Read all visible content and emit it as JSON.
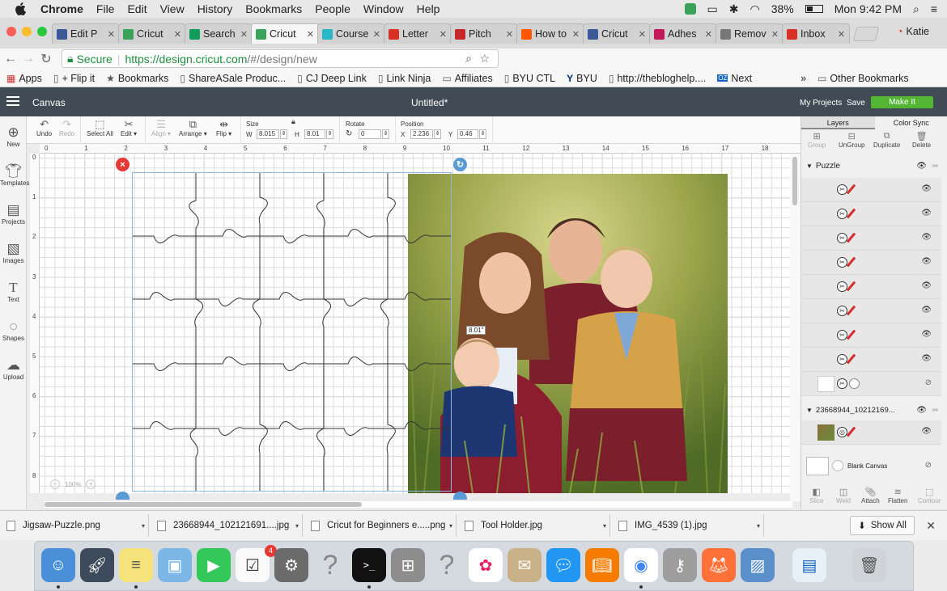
{
  "menubar": {
    "app": "Chrome",
    "items": [
      "File",
      "Edit",
      "View",
      "History",
      "Bookmarks",
      "People",
      "Window",
      "Help"
    ],
    "battery": "38%",
    "clock": "Mon 9:42 PM"
  },
  "tabs": [
    {
      "title": "Edit P",
      "color": "#3b5998"
    },
    {
      "title": "Cricut",
      "color": "#3aa35a"
    },
    {
      "title": "Search",
      "color": "#0f9d58"
    },
    {
      "title": "Cricut",
      "color": "#3aa35a",
      "active": true
    },
    {
      "title": "Course",
      "color": "#29b6c6"
    },
    {
      "title": "Letter",
      "color": "#d93025"
    },
    {
      "title": "Pitch",
      "color": "#c62828"
    },
    {
      "title": "How to",
      "color": "#ff5700"
    },
    {
      "title": "Cricut",
      "color": "#3b5998"
    },
    {
      "title": "Adhes",
      "color": "#c2185b"
    },
    {
      "title": "Remov",
      "color": "#777777"
    },
    {
      "title": "Inbox",
      "color": "#d93025"
    }
  ],
  "profile_name": "Katie",
  "omnibox": {
    "secure_label": "Secure",
    "url_host": "https://design.cricut.com",
    "url_path": "/#/design/new"
  },
  "bookmarks": [
    "Apps",
    "+ Flip it",
    "Bookmarks",
    "ShareASale Produc...",
    "CJ Deep Link",
    "Link Ninja",
    "Affiliates",
    "BYU CTL",
    "BYU",
    "http://theblogh­elp....",
    "Next"
  ],
  "bookmarks_overflow": "»",
  "bookmarks_other": "Other Bookmarks",
  "app_header": {
    "canvas_label": "Canvas",
    "doc_title": "Untitled*",
    "my_projects": "My Projects",
    "save": "Save",
    "make_it": "Make It"
  },
  "left_tools": [
    "New",
    "Templates",
    "Projects",
    "Images",
    "Text",
    "Shapes",
    "Upload"
  ],
  "toolbar": {
    "undo": "Undo",
    "redo": "Redo",
    "select_all": "Select All",
    "edit": "Edit",
    "align": "Align",
    "arrange": "Arrange",
    "flip": "Flip",
    "size_label": "Size",
    "w_label": "W",
    "w_value": "8.015",
    "h_label": "H",
    "h_value": "8.01",
    "rotate_label": "Rotate",
    "rotate_value": "0",
    "position_label": "Position",
    "x_label": "X",
    "x_value": "2.236",
    "y_label": "Y",
    "y_value": "0.46"
  },
  "ruler_top": [
    "0",
    "1",
    "2",
    "3",
    "4",
    "5",
    "6",
    "7",
    "8",
    "9",
    "10",
    "11",
    "12",
    "13",
    "14",
    "15",
    "16",
    "17",
    "18"
  ],
  "ruler_left": [
    "0",
    "1",
    "2",
    "3",
    "4",
    "5",
    "6",
    "7",
    "8"
  ],
  "canvas": {
    "dimension_label": "8.01\"",
    "zoom": "100%"
  },
  "layers_panel": {
    "tab_layers": "Layers",
    "tab_color_sync": "Color Sync",
    "actions": [
      "Group",
      "UnGroup",
      "Duplicate",
      "Delete"
    ],
    "group_puzzle": "Puzzle",
    "group_image": "23668944_10212169...",
    "blank_canvas": "Blank Canvas",
    "bottom_actions": [
      "Slice",
      "Weld",
      "Attach",
      "Flatten",
      "Contour"
    ]
  },
  "downloads": [
    {
      "name": "Jigsaw-Puzzle.png"
    },
    {
      "name": "23668944_102121691....jpg"
    },
    {
      "name": "Cricut for Beginners e.....png"
    },
    {
      "name": "Tool Holder.jpg"
    },
    {
      "name": "IMG_4539 (1).jpg"
    }
  ],
  "downloads_show_all": "Show All",
  "dock_badge": "4"
}
